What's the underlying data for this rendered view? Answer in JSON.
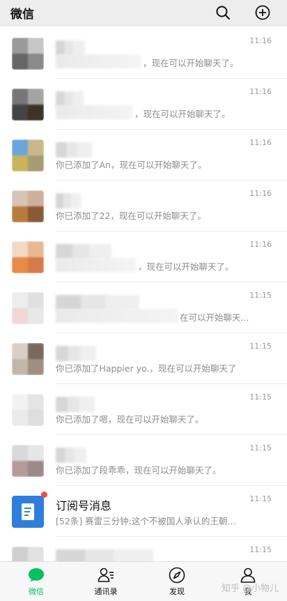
{
  "header": {
    "title": "微信",
    "search_icon": "search-icon",
    "add_icon": "plus-circle-icon"
  },
  "chats": [
    {
      "time": "11:16",
      "preview": "，现在可以开始聊天了。"
    },
    {
      "time": "11:16",
      "preview": "，现在可以开始聊天了。"
    },
    {
      "time": "11:16",
      "preview": "你已添加了An，现在可以开始聊天了。"
    },
    {
      "time": "11:16",
      "preview": "你已添加了22，现在可以开始聊天了。"
    },
    {
      "time": "11:16",
      "preview": "，现在可以开始聊天了。"
    },
    {
      "time": "11:15",
      "preview": "在可以开始聊天..."
    },
    {
      "time": "11:15",
      "preview": "你已添加了Happier yo.，现在可以开始聊天了"
    },
    {
      "time": "11:15",
      "preview": "你已添加了嗯，现在可以开始聊天了。"
    },
    {
      "time": "11:15",
      "preview": "你已添加了段乖乖，现在可以开始聊天了。"
    },
    {
      "time": "11:15",
      "name": "订阅号消息",
      "preview": "[52条] 赛雷三分钟:这个不被国人承认的王朝，..."
    },
    {
      "time": "11:15",
      "preview": ""
    }
  ],
  "tabs": [
    {
      "label": "微信",
      "icon": "chat-bubble-icon",
      "active": true
    },
    {
      "label": "通讯录",
      "icon": "contacts-icon",
      "active": false
    },
    {
      "label": "发现",
      "icon": "compass-icon",
      "active": false
    },
    {
      "label": "我",
      "icon": "person-icon",
      "active": false
    }
  ],
  "watermark": "知乎 @小物儿",
  "colors": {
    "accent": "#07c160",
    "badge": "#f24a4a",
    "topbar": "#ededed"
  }
}
